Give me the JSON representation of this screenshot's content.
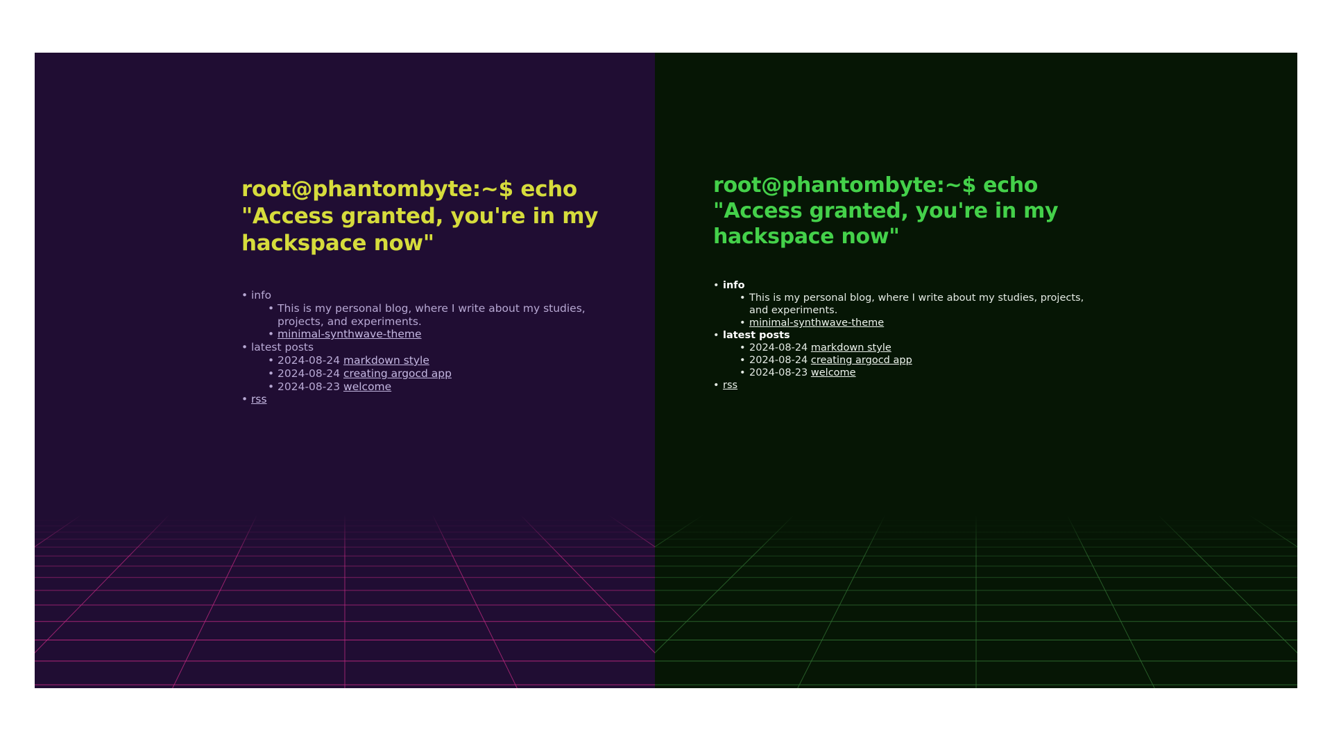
{
  "themes": [
    {
      "id": "synthwave",
      "accent": "#d6dc3c",
      "background": "#200d33",
      "grid_color": "#b8287e",
      "prompt": "root@phantombyte:~$ echo \"Access granted, you're in my hackspace now\"",
      "menu": {
        "info_label": "info",
        "info_text": "This is my personal blog, where I write about my studies, projects, and experiments.",
        "theme_link": "minimal-synthwave-theme",
        "latest_label": "latest posts",
        "posts": [
          {
            "date": "2024-08-24",
            "title": "markdown style"
          },
          {
            "date": "2024-08-24",
            "title": "creating argocd app"
          },
          {
            "date": "2024-08-23",
            "title": "welcome"
          }
        ],
        "rss_label": "rss"
      }
    },
    {
      "id": "matrix",
      "accent": "#44d14a",
      "background": "#061605",
      "grid_color": "#2f6d30",
      "prompt": "root@phantombyte:~$ echo \"Access granted, you're in my hackspace now\"",
      "menu": {
        "info_label": "info",
        "info_text": "This is my personal blog, where I write about my studies, projects, and experiments.",
        "theme_link": "minimal-synthwave-theme",
        "latest_label": "latest posts",
        "posts": [
          {
            "date": "2024-08-24",
            "title": "markdown style"
          },
          {
            "date": "2024-08-24",
            "title": "creating argocd app"
          },
          {
            "date": "2024-08-23",
            "title": "welcome"
          }
        ],
        "rss_label": "rss"
      }
    }
  ]
}
